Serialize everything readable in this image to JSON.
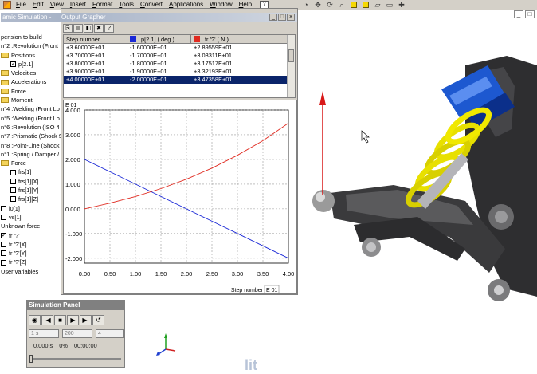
{
  "menubar": {
    "items": [
      "File",
      "Edit",
      "View",
      "Insert",
      "Format",
      "Tools",
      "Convert",
      "Applications",
      "Window",
      "Help"
    ],
    "help_box": "?"
  },
  "top_toolbar": {
    "icons": [
      "circle-arrow-icon",
      "move-icon",
      "rotate-icon",
      "zoom-icon",
      "cube-icon",
      "plane-icon",
      "rectangle-icon"
    ]
  },
  "window_controls": [
    "_",
    "□"
  ],
  "tree": {
    "rows": [
      {
        "indent": 0,
        "kind": "text",
        "label": "pension to build"
      },
      {
        "indent": 0,
        "kind": "text",
        "label": "n°2 :Revolution (Front"
      },
      {
        "indent": 0,
        "kind": "folder",
        "label": "Positions"
      },
      {
        "indent": 12,
        "kind": "check",
        "checked": true,
        "label": "p[2.1]"
      },
      {
        "indent": 0,
        "kind": "folder",
        "label": "Velocities"
      },
      {
        "indent": 0,
        "kind": "folder",
        "label": "Accelerations"
      },
      {
        "indent": 0,
        "kind": "folder",
        "label": "Force"
      },
      {
        "indent": 0,
        "kind": "folder",
        "label": "Moment"
      },
      {
        "indent": 0,
        "kind": "text",
        "label": "n°4 :Welding (Front Lo"
      },
      {
        "indent": 0,
        "kind": "text",
        "label": "n°5 :Welding (Front Lo"
      },
      {
        "indent": 0,
        "kind": "text",
        "label": "n°6 :Revolution (ISO 4"
      },
      {
        "indent": 0,
        "kind": "text",
        "label": "n°7 :Prismatic (Shock S"
      },
      {
        "indent": 0,
        "kind": "text",
        "label": "n°8 :Point-Line (Shock I"
      },
      {
        "indent": 0,
        "kind": "text",
        "label": "n°1 :Spring / Damper /"
      },
      {
        "indent": 0,
        "kind": "folder",
        "label": "Force"
      },
      {
        "indent": 12,
        "kind": "check",
        "checked": false,
        "label": "frs[1]"
      },
      {
        "indent": 12,
        "kind": "check",
        "checked": false,
        "label": "frs[1][X]"
      },
      {
        "indent": 12,
        "kind": "check",
        "checked": false,
        "label": "frs[1][Y]"
      },
      {
        "indent": 12,
        "kind": "check",
        "checked": false,
        "label": "frs[1][Z]"
      },
      {
        "indent": 0,
        "kind": "check",
        "checked": false,
        "label": "l0[1]"
      },
      {
        "indent": 0,
        "kind": "check",
        "checked": false,
        "label": "vs[1]"
      },
      {
        "indent": 0,
        "kind": "text",
        "label": "Unknown force"
      },
      {
        "indent": 0,
        "kind": "check",
        "checked": true,
        "label": "fr '?'"
      },
      {
        "indent": 0,
        "kind": "check",
        "checked": false,
        "label": "fr '?'[X]"
      },
      {
        "indent": 0,
        "kind": "check",
        "checked": false,
        "label": "fr '?'[Y]"
      },
      {
        "indent": 0,
        "kind": "check",
        "checked": false,
        "label": "fr '?'[Z]"
      },
      {
        "indent": 0,
        "kind": "text",
        "label": "User variables"
      }
    ]
  },
  "grapher": {
    "title_prefix": "amic Simulation -",
    "title": "Output Grapher",
    "toolbar": [
      "⎘",
      "▤",
      "◧",
      "✖",
      "?"
    ],
    "controls": [
      "_",
      "□",
      "×"
    ],
    "table": {
      "headers": [
        "Step number",
        "p[2.1] ( deg )",
        "fr '?' ( N )"
      ],
      "header_colors": [
        "",
        "#1a28d6",
        "#e02a20"
      ],
      "rows": [
        [
          "+3.60000E+01",
          "-1.60000E+01",
          "+2.89559E+01"
        ],
        [
          "+3.70000E+01",
          "-1.70000E+01",
          "+3.03311E+01"
        ],
        [
          "+3.80000E+01",
          "-1.80000E+01",
          "+3.17517E+01"
        ],
        [
          "+3.90000E+01",
          "-1.90000E+01",
          "+3.32193E+01"
        ],
        [
          "+4.00000E+01",
          "-2.00000E+01",
          "+3.47358E+01"
        ]
      ],
      "selected_row": 4
    },
    "chart_tag": "E 01"
  },
  "chart_data": {
    "type": "line",
    "title": "",
    "xlabel": "Step number",
    "x_unit_tag": "E 01",
    "y_unit_tag": "E 01",
    "xlim": [
      0,
      4
    ],
    "ylim": [
      -2.2,
      4.0
    ],
    "x_ticks": [
      "0.00",
      "0.50",
      "1.00",
      "1.50",
      "2.00",
      "2.50",
      "3.00",
      "3.50",
      "4.00"
    ],
    "y_ticks": [
      {
        "value": 4.0,
        "label": "4.000"
      },
      {
        "value": 3.0,
        "label": "3.000"
      },
      {
        "value": 2.0,
        "label": "2.000"
      },
      {
        "value": 1.0,
        "label": "1.000"
      },
      {
        "value": 0.0,
        "label": "0.000"
      },
      {
        "value": -1.0,
        "label": "-1.000"
      },
      {
        "value": -2.0,
        "label": "-2.000"
      }
    ],
    "grid": true,
    "series": [
      {
        "name": "p[2.1] ( deg )",
        "color": "#1a28d6",
        "x": [
          0,
          0.5,
          1.0,
          1.5,
          2.0,
          2.5,
          3.0,
          3.5,
          4.0
        ],
        "y": [
          2.0,
          1.5,
          1.0,
          0.5,
          0.0,
          -0.5,
          -1.0,
          -1.5,
          -2.0
        ]
      },
      {
        "name": "fr '?' ( N )",
        "color": "#e02a20",
        "x": [
          0,
          0.5,
          1.0,
          1.5,
          2.0,
          2.5,
          3.0,
          3.5,
          4.0
        ],
        "y": [
          0.0,
          0.23,
          0.5,
          0.82,
          1.2,
          1.65,
          2.17,
          2.76,
          3.47
        ]
      }
    ]
  },
  "sim_panel": {
    "title": "Simulation Panel",
    "buttons": [
      "◉",
      "|◀",
      "■",
      "▶",
      "▶|",
      "↺"
    ],
    "fields": [
      "1 s",
      "200",
      "4"
    ],
    "status": [
      "0.000 s",
      "0%",
      "00:00:00"
    ],
    "progress": 0
  },
  "bottom_text": "lit"
}
